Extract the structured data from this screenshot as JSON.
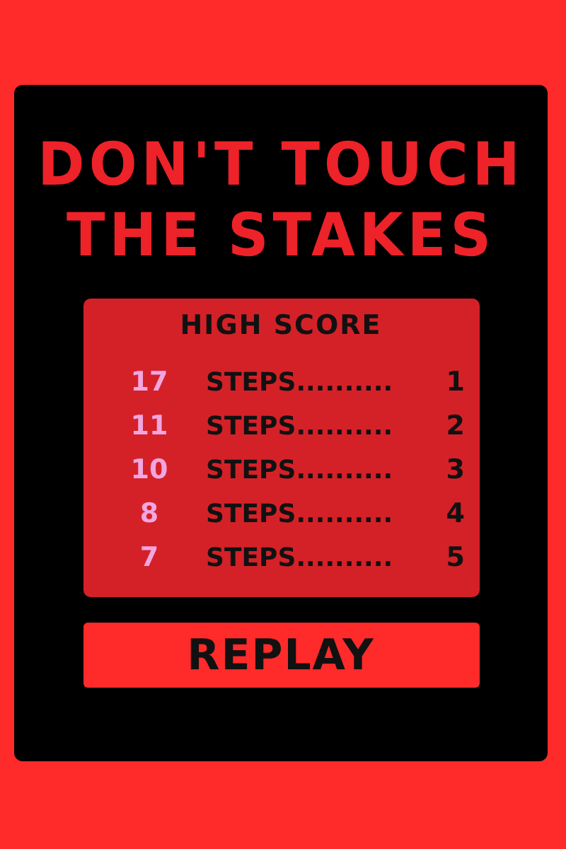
{
  "title": [
    "DON'T TOUCH",
    "THE STAKES"
  ],
  "high_score": {
    "heading": "HIGH SCORE",
    "rows": [
      {
        "score": "17",
        "label": "STEPS..........",
        "rank": "1"
      },
      {
        "score": "11",
        "label": "STEPS..........",
        "rank": "2"
      },
      {
        "score": "10",
        "label": "STEPS..........",
        "rank": "3"
      },
      {
        "score": "8",
        "label": "STEPS..........",
        "rank": "4"
      },
      {
        "score": "7",
        "label": "STEPS..........",
        "rank": "5"
      }
    ]
  },
  "button": "REPLAY"
}
